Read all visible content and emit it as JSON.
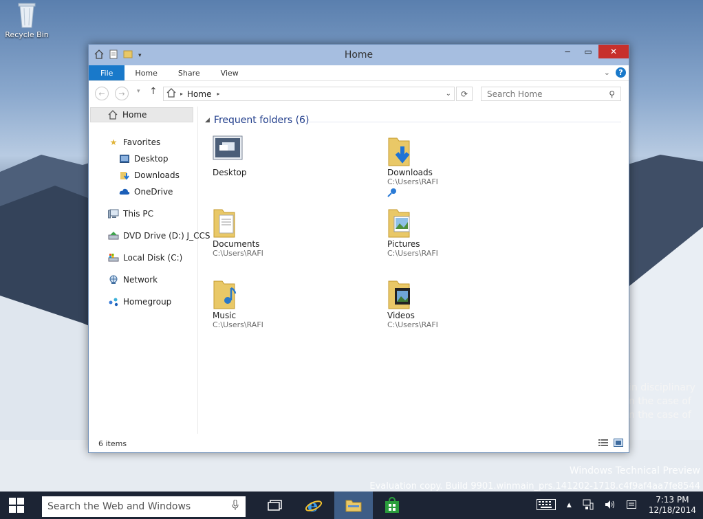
{
  "desktop": {
    "recycle_bin_label": "Recycle Bin",
    "bg_text_lines": [
      "in disciplinary",
      "n the case of",
      "n the case of"
    ],
    "watermark_line1": "Windows Technical Preview",
    "watermark_line2": "Evaluation copy. Build 9901.winmain_prs.141202-1718.c4f9af4aa7fe8544"
  },
  "window": {
    "title": "Home",
    "minimize_label": "−",
    "maximize_label": "▭",
    "close_label": "✕"
  },
  "ribbon": {
    "file": "File",
    "tabs": [
      "Home",
      "Share",
      "View"
    ],
    "help_label": "?"
  },
  "address": {
    "breadcrumb": "Home",
    "search_placeholder": "Search Home"
  },
  "nav": {
    "home": "Home",
    "favorites": "Favorites",
    "desktop": "Desktop",
    "downloads": "Downloads",
    "onedrive": "OneDrive",
    "this_pc": "This PC",
    "dvd": "DVD Drive (D:) J_CCS",
    "local_disk": "Local Disk (C:)",
    "network": "Network",
    "homegroup": "Homegroup"
  },
  "content": {
    "group_title": "Frequent folders (6)",
    "folders": [
      {
        "name": "Desktop",
        "path": ""
      },
      {
        "name": "Downloads",
        "path": "C:\\Users\\RAFI"
      },
      {
        "name": "Documents",
        "path": "C:\\Users\\RAFI"
      },
      {
        "name": "Pictures",
        "path": "C:\\Users\\RAFI"
      },
      {
        "name": "Music",
        "path": "C:\\Users\\RAFI"
      },
      {
        "name": "Videos",
        "path": "C:\\Users\\RAFI"
      }
    ]
  },
  "status": {
    "item_count": "6 items"
  },
  "taskbar": {
    "search_placeholder": "Search the Web and Windows",
    "time": "7:13 PM",
    "date": "12/18/2014"
  },
  "colors": {
    "accent": "#1979ca",
    "titlebar": "#a6bee0",
    "close": "#c7302b",
    "taskbar": "#1c2434"
  }
}
